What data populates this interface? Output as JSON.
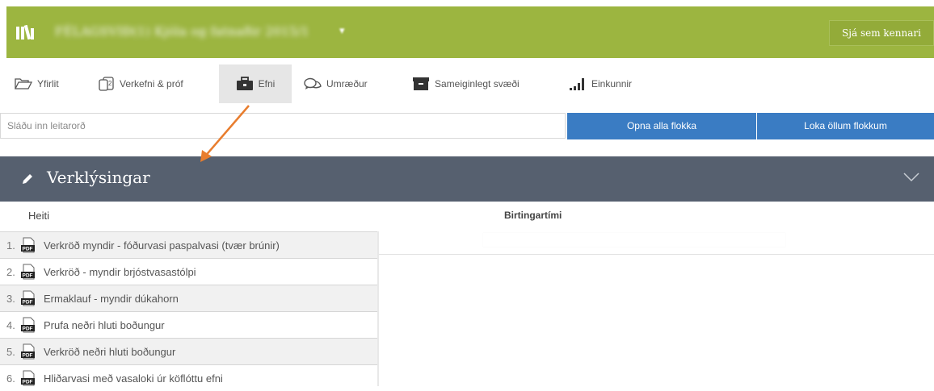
{
  "header": {
    "course_title": "FÉLAGSVIÐ(1) Kjóla og fatnaðir 2015/1",
    "course_caret": "▾",
    "teacher_button": "Sjá sem kennari",
    "bar_color": "#9cb540"
  },
  "nav": {
    "tabs": [
      {
        "label": "Yfirlit",
        "icon": "folder-open-icon"
      },
      {
        "label": "Verkefni & próf",
        "icon": "documents-icon"
      },
      {
        "label": "Efni",
        "icon": "briefcase-icon",
        "active": true
      },
      {
        "label": "Umræður",
        "icon": "chat-bubbles-icon"
      },
      {
        "label": "Sameiginlegt svæði",
        "icon": "archive-box-icon"
      },
      {
        "label": "Einkunnir",
        "icon": "bar-chart-icon"
      }
    ]
  },
  "search": {
    "placeholder": "Sláðu inn leitarorð",
    "open_all": "Opna alla flokka",
    "close_all": "Loka öllum flokkum",
    "button_color": "#3a7cc3"
  },
  "section": {
    "title": "Verklýsingar",
    "header_color": "#56606f"
  },
  "table": {
    "col_name": "Heiti",
    "col_published": "Birtingartími",
    "files": [
      {
        "num": "1.",
        "name": "Verkröð myndir - fóðurvasi paspalvasi (tvær brúnir)"
      },
      {
        "num": "2.",
        "name": "Verkröð - myndir brjóstvasastólpi"
      },
      {
        "num": "3.",
        "name": "Ermaklauf - myndir dúkahorn"
      },
      {
        "num": "4.",
        "name": "Prufa neðri hluti boðungur"
      },
      {
        "num": "5.",
        "name": "Verkröð neðri hluti boðungur"
      },
      {
        "num": "6.",
        "name": "Hliðarvasi með vasaloki úr köflóttu efni"
      }
    ]
  },
  "annotation": {
    "arrow_color": "#e87d2e"
  }
}
